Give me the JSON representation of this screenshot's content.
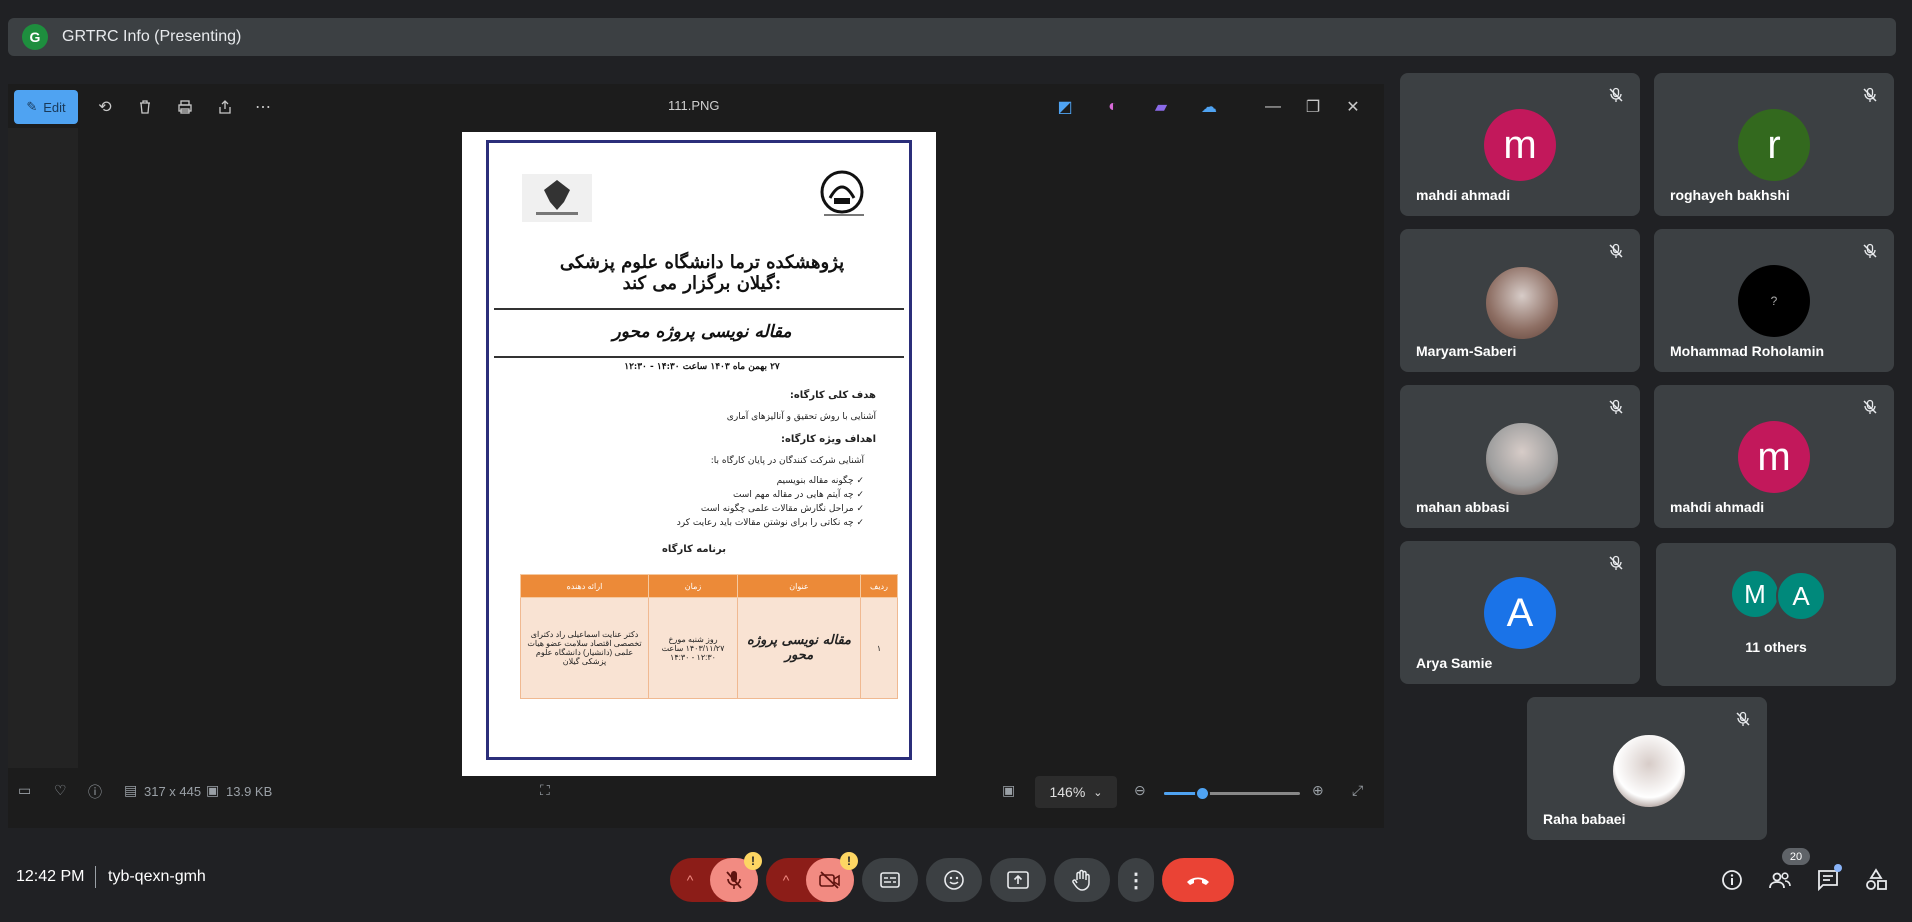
{
  "meeting": {
    "presenter_initial": "G",
    "title": "GRTRC Info (Presenting)",
    "time": "12:42 PM",
    "code": "tyb-qexn-gmh",
    "participant_count": "20"
  },
  "viewer": {
    "edit_label": "Edit",
    "file_name": "111.PNG",
    "dimensions": "317 x 445",
    "file_size": "13.9 KB",
    "zoom": "146%",
    "zoom_level": 0.28
  },
  "document": {
    "title": "پژوهشکده ترما دانشگاه علوم پزشکی گیلان برگزار می کند:",
    "subtitle": "مقاله نویسی پروژه محور",
    "date_line": "۲۷ بهمن ماه ۱۴۰۳ ساعت ۱۴:۳۰ - ۱۲:۳۰",
    "general_goal_heading": "هدف کلی کارگاه:",
    "general_goal": "آشنایی با روش تحقیق و آنالیزهای آماری",
    "specific_goals_heading": "اهداف ویژه کارگاه:",
    "specific_intro": "آشنایی شرکت کنندگان در پایان کارگاه با:",
    "specific_items": [
      "چگونه مقاله بنویسیم",
      "چه آیتم هایی در مقاله مهم است",
      "مراحل نگارش مقالات علمی چگونه است",
      "چه نکاتی را برای نوشتن مقالات باید رعایت کرد"
    ],
    "program_heading": "برنامه کارگاه",
    "table_headers": [
      "ردیف",
      "عنوان",
      "زمان",
      "ارائه دهنده"
    ],
    "table_row": {
      "index": "۱",
      "topic": "مقاله نویسی پروژه محور",
      "time": "روز شنبه مورخ ۱۴۰۳/۱۱/۲۷ ساعت ۱۲:۳۰ - ۱۴:۳۰",
      "presenter": "دکتر عنایت اسماعیلی راد دکترای تخصصی اقتصاد سلامت عضو هیات علمی (دانشیار) دانشگاه علوم پزشکی گیلان"
    }
  },
  "participants": [
    {
      "name": "mahdi ahmadi",
      "initial": "m",
      "color": "#c2185b",
      "type": "letter"
    },
    {
      "name": "roghayeh bakhshi",
      "initial": "r",
      "color": "#33691e",
      "type": "letter"
    },
    {
      "name": "Maryam-Saberi",
      "initial": "",
      "color": "#8d6e63",
      "type": "photo"
    },
    {
      "name": "Mohammad Roholamin",
      "initial": "?",
      "color": "#000000",
      "type": "letter"
    },
    {
      "name": "mahan abbasi",
      "initial": "",
      "color": "#9e9e9e",
      "type": "photo"
    },
    {
      "name": "mahdi ahmadi",
      "initial": "m",
      "color": "#c2185b",
      "type": "letter"
    },
    {
      "name": "Arya Samie",
      "initial": "A",
      "color": "#1a73e8",
      "type": "letter"
    },
    {
      "name": "Raha babaei",
      "initial": "",
      "color": "#ffffff",
      "type": "photo"
    }
  ],
  "others": {
    "label": "11 others",
    "initials": [
      "M",
      "A"
    ],
    "colors": [
      "#00897b",
      "#00897b"
    ]
  },
  "colors": {
    "accent": "#4fa3f2",
    "end_call": "#ea4335",
    "muted_control": "#f28b82",
    "muted_control_dark": "#8c1d18"
  }
}
